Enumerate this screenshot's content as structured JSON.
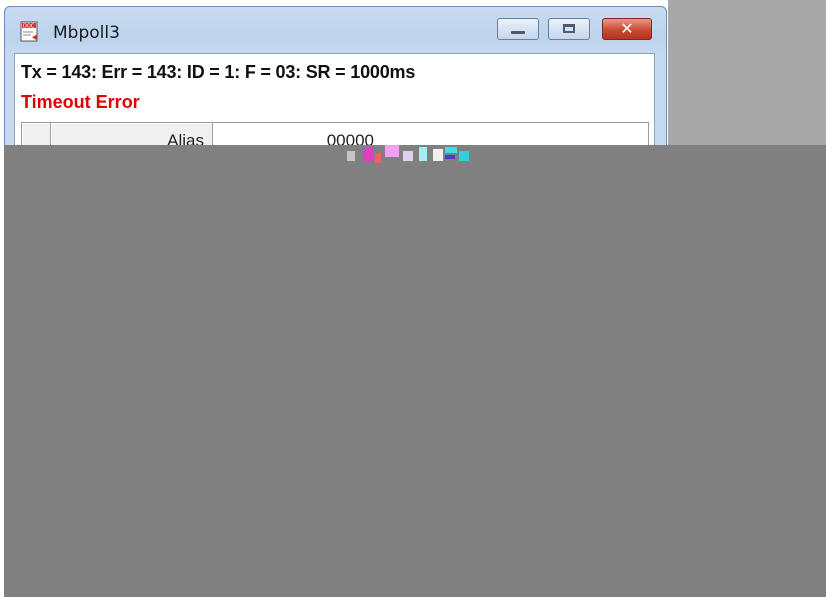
{
  "window": {
    "title": "Mbpoll3",
    "icon": "document-icon",
    "controls": {
      "minimize": "minimize-icon",
      "maximize": "maximize-icon",
      "close": "close-icon"
    }
  },
  "status_line": "Tx = 143: Err = 143: ID = 1: F = 03: SR = 1000ms",
  "error_message": "Timeout Error",
  "grid": {
    "header_label": "Alias",
    "first_value": "00000"
  },
  "colors": {
    "error": "#e00000",
    "overlay": "#808080",
    "close_button": "#c94a33"
  }
}
